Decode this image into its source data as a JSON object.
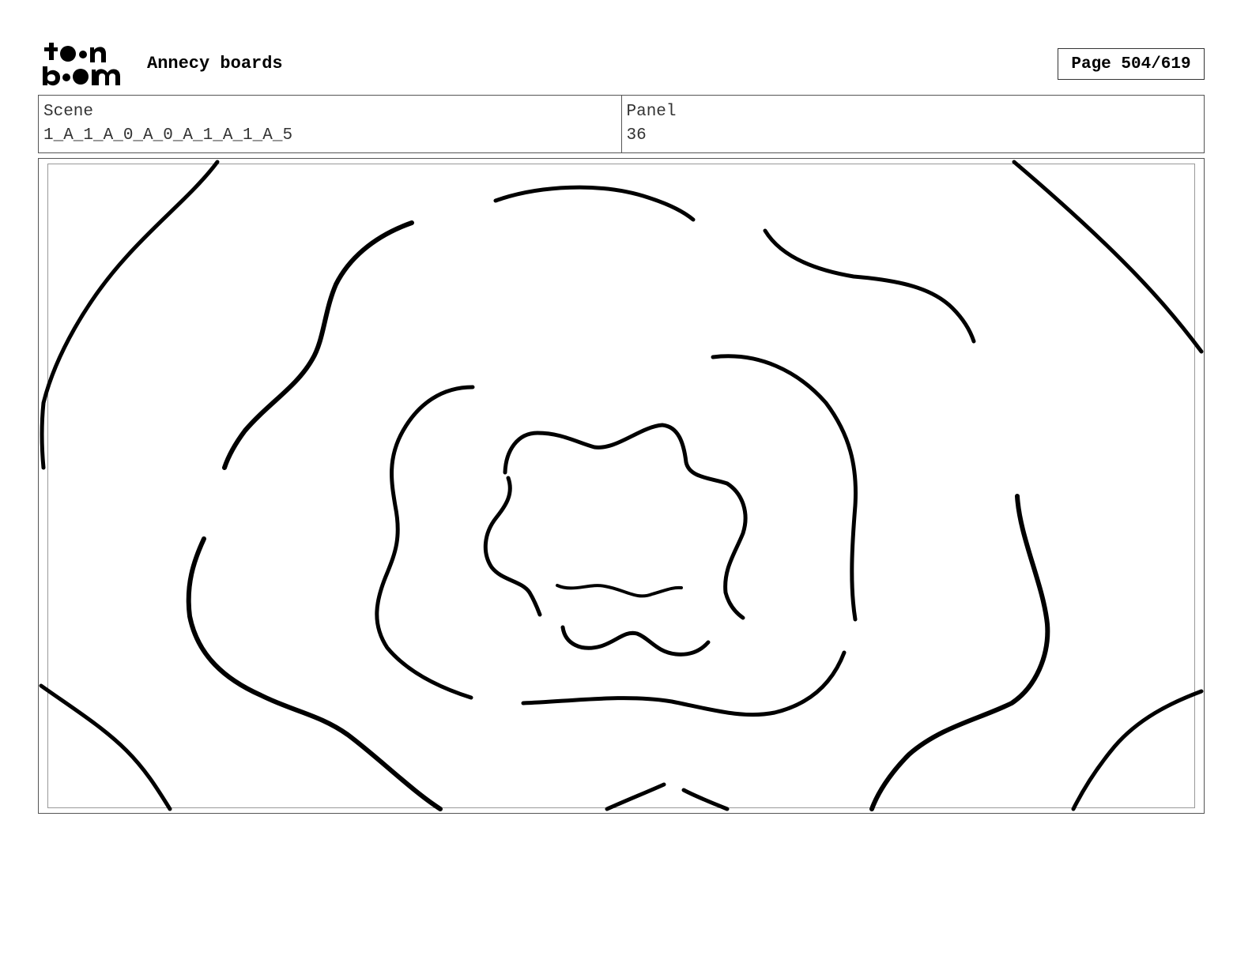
{
  "header": {
    "logo_text": "toon boom",
    "project_title": "Annecy boards",
    "page_indicator": "Page 504/619"
  },
  "info": {
    "scene_label": "Scene",
    "scene_value": "1_A_1_A_0_A_0_A_1_A_1_A_5",
    "panel_label": "Panel",
    "panel_value": "36"
  }
}
